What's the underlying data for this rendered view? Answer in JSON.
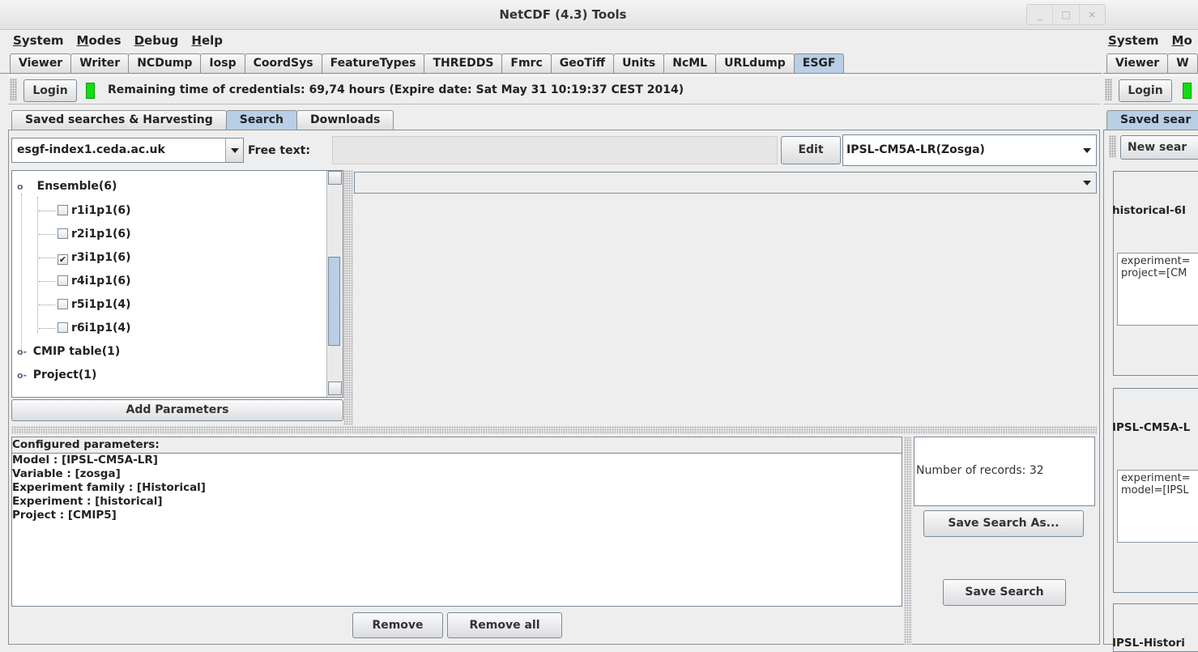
{
  "window": {
    "title": "NetCDF (4.3) Tools",
    "controls": [
      "_",
      "□",
      "×"
    ]
  },
  "menu": [
    "System",
    "Modes",
    "Debug",
    "Help"
  ],
  "right_menu": [
    "System",
    "Mo"
  ],
  "tabs": [
    "Viewer",
    "Writer",
    "NCDump",
    "Iosp",
    "CoordSys",
    "FeatureTypes",
    "THREDDS",
    "Fmrc",
    "GeoTiff",
    "Units",
    "NcML",
    "URLdump",
    "ESGF"
  ],
  "active_tab": "ESGF",
  "right_tabs": [
    "Viewer",
    "W"
  ],
  "toolbar": {
    "login_label": "Login",
    "credentials": "Remaining time of credentials: 69,74 hours (Expire date: Sat May 31 10:19:37 CEST 2014)"
  },
  "subtabs": [
    "Saved searches & Harvesting",
    "Search",
    "Downloads"
  ],
  "right_subtab": "Saved sear",
  "search": {
    "index_node": "esgf-index1.ceda.ac.uk",
    "free_text_label": "Free text:",
    "free_text_value": "",
    "edit_label": "Edit",
    "saved_selected": "IPSL-CM5A-LR(Zosga)",
    "facet_selected": ""
  },
  "tree": {
    "ensemble_label": "Ensemble(6)",
    "members": [
      {
        "label": "r1i1p1(6)",
        "checked": false
      },
      {
        "label": "r2i1p1(6)",
        "checked": false
      },
      {
        "label": "r3i1p1(6)",
        "checked": true
      },
      {
        "label": "r4i1p1(6)",
        "checked": false
      },
      {
        "label": "r5i1p1(4)",
        "checked": false
      },
      {
        "label": "r6i1p1(4)",
        "checked": false
      }
    ],
    "cmip_label": "CMIP table(1)",
    "project_label": "Project(1)"
  },
  "add_parameters_label": "Add Parameters",
  "configured": {
    "header": "Configured parameters:",
    "lines": [
      "Model : [IPSL-CM5A-LR]",
      "Variable : [zosga]",
      "Experiment family : [Historical]",
      "Experiment : [historical]",
      "Project : [CMIP5]"
    ]
  },
  "records": "Number of records: 32",
  "save_as_label": "Save Search As...",
  "save_label": "Save Search",
  "remove_label": "Remove",
  "remove_all_label": "Remove all",
  "right_panel": {
    "new_search_label": "New sear",
    "cards": [
      {
        "title": "historical-6I",
        "text1": "experiment=",
        "text2": "project=[CM"
      },
      {
        "title": "IPSL-CM5A-L",
        "text1": "experiment=",
        "text2": "model=[IPSL"
      },
      {
        "title": "IPSL-Histori",
        "text1": "",
        "text2": ""
      }
    ]
  }
}
